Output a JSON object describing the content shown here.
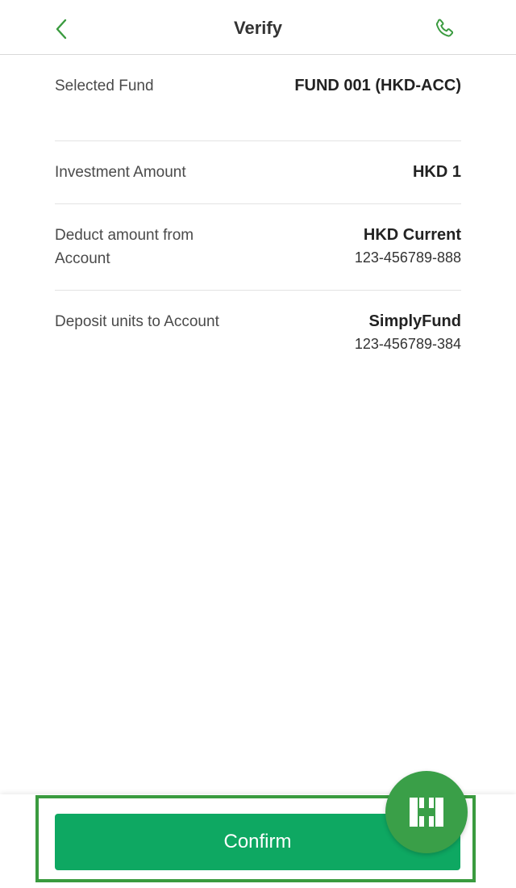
{
  "header": {
    "title": "Verify",
    "back_icon": "chevron-left-icon",
    "phone_icon": "phone-icon"
  },
  "colors": {
    "accent": "#3a9b3f",
    "button": "#0ea862"
  },
  "details": [
    {
      "label": "Selected Fund",
      "value": "FUND 001 (HKD-ACC)",
      "sub": ""
    },
    {
      "label": "Investment Amount",
      "value": "HKD 1",
      "sub": ""
    },
    {
      "label": "Deduct amount from Account",
      "value": "HKD Current",
      "sub": "123-456789-888"
    },
    {
      "label": "Deposit units to Account",
      "value": "SimplyFund",
      "sub": "123-456789-384"
    }
  ],
  "footer": {
    "confirm_label": "Confirm",
    "fab_icon": "bank-logo-icon"
  }
}
